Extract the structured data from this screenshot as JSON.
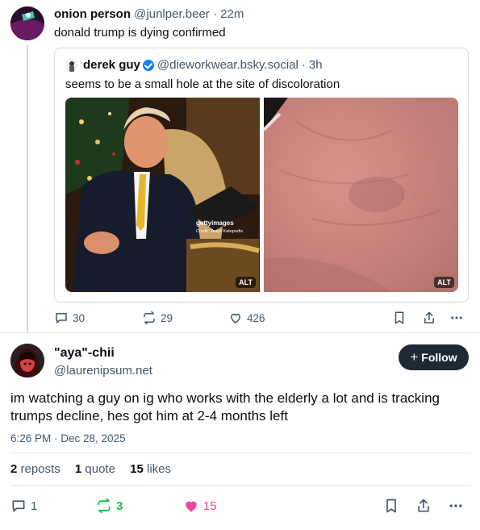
{
  "post1": {
    "author_name": "onion person",
    "author_handle": "@junlper.beer",
    "separator": "·",
    "time": "22m",
    "text": "donald trump is dying confirmed",
    "quote": {
      "author_name": "derek guy",
      "author_handle": "@dieworkwear.bsky.social",
      "time": "3h",
      "text": "seems to be a small hole at the site of discoloration",
      "images": [
        {
          "alt_label": "ALT",
          "watermark": "gettyimages",
          "credit": "Credit: Tasos Katopodis"
        },
        {
          "alt_label": "ALT"
        }
      ]
    },
    "actions": {
      "replies": "30",
      "reposts": "29",
      "likes": "426"
    }
  },
  "post2": {
    "author_name": "\"aya\"-chii",
    "author_handle": "@laurenipsum.net",
    "follow_label": "Follow",
    "text": "im watching a guy on ig who works with the elderly a lot and is tracking trumps decline, hes got him at 2-4 months left",
    "datetime": "6:26 PM · Dec 28, 2025",
    "stats": {
      "reposts_count": "2",
      "reposts_label": "reposts",
      "quotes_count": "1",
      "quotes_label": "quote",
      "likes_count": "15",
      "likes_label": "likes"
    },
    "actions": {
      "replies": "1",
      "reposts": "3",
      "likes": "15"
    }
  },
  "colors": {
    "muted": "#42576c",
    "repost_active": "#13c04a",
    "like_active": "#ec4899",
    "follow_bg": "#1e2936",
    "verified": "#1083fe"
  }
}
